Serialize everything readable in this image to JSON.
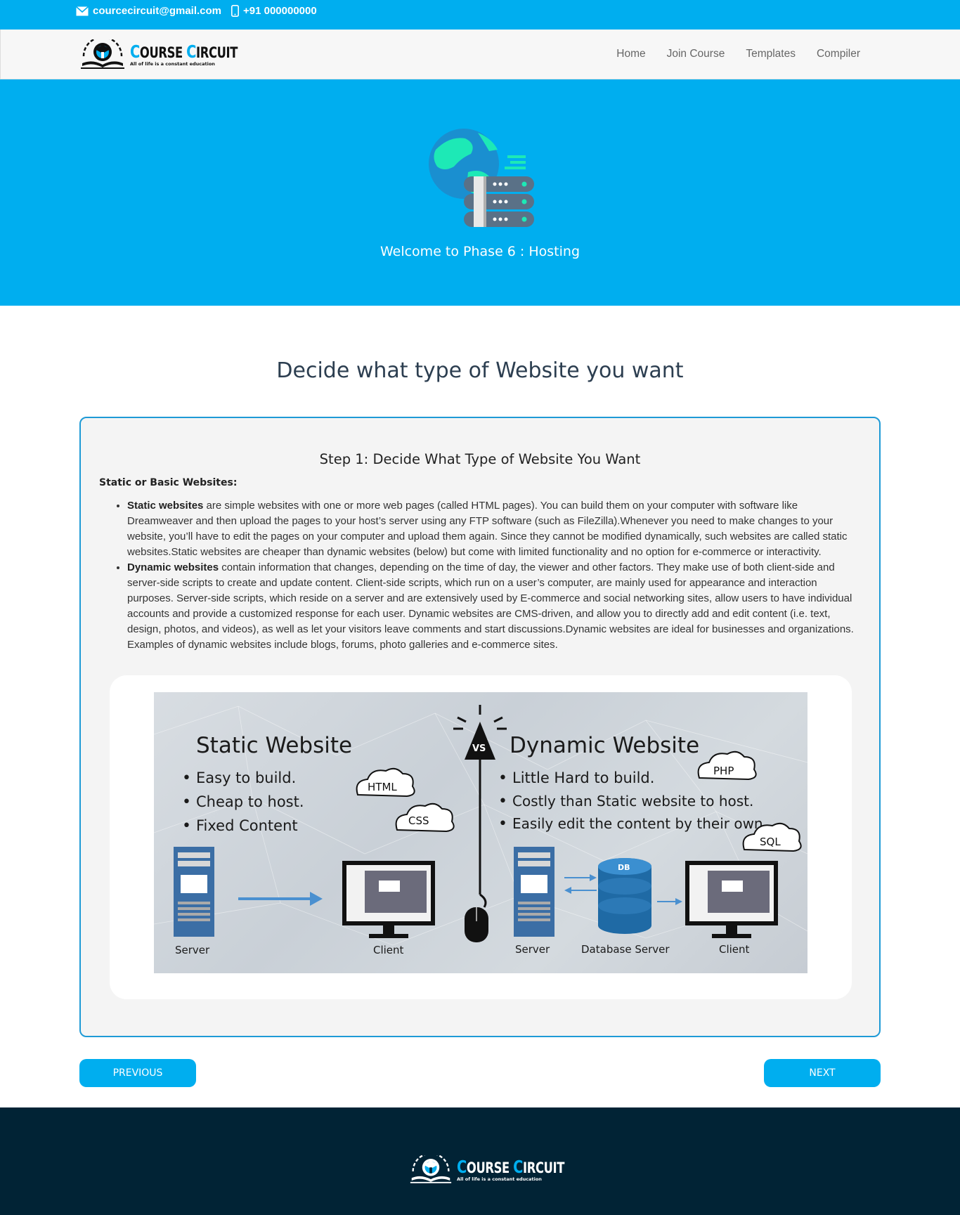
{
  "topbar": {
    "email": "courcecircuit@gmail.com",
    "phone": "+91 000000000"
  },
  "brand": {
    "name_first_cap": "C",
    "name_first_rest": "OURSE",
    "name_second_cap": "C",
    "name_second_rest": "IRCUIT",
    "tagline": "All of life is a constant education"
  },
  "nav": {
    "items": [
      {
        "label": "Home"
      },
      {
        "label": "Join Course"
      },
      {
        "label": "Templates"
      },
      {
        "label": "Compiler"
      }
    ]
  },
  "hero": {
    "title": "Welcome to Phase 6 : Hosting"
  },
  "main": {
    "title": "Decide what type of Website you want"
  },
  "card": {
    "step_title": "Step 1: Decide What Type of Website You Want",
    "section_label": "Static or Basic Websites:",
    "items": [
      {
        "term": "Static websites",
        "text": " are simple websites with one or more web pages (called HTML pages). You can build them on your computer with software like Dreamweaver and then upload the pages to your host’s server using any FTP software (such as FileZilla).Whenever you need to make changes to your website, you’ll have to edit the pages on your computer and upload them again. Since they cannot be modified dynamically, such websites are called static websites.Static websites are cheaper than dynamic websites (below) but come with limited functionality and no option for e-commerce or interactivity."
      },
      {
        "term": "Dynamic websites",
        "text": " contain information that changes, depending on the time of day, the viewer and other factors. They make use of both client-side and server-side scripts to create and update content. Client-side scripts, which run on a user’s computer, are mainly used for appearance and interaction purposes. Server-side scripts, which reside on a server and are extensively used by E-commerce and social networking sites, allow users to have individual accounts and provide a customized response for each user. Dynamic websites are CMS-driven, and allow you to directly add and edit content (i.e. text, design, photos, and videos), as well as let your visitors leave comments and start discussions.Dynamic websites are ideal for businesses and organizations. Examples of dynamic websites include blogs, forums, photo galleries and e-commerce sites."
      }
    ]
  },
  "infographic": {
    "static_title": "Static Website",
    "static_points": [
      "Easy to build.",
      "Cheap to host.",
      "Fixed Content"
    ],
    "dynamic_title": "Dynamic Website",
    "dynamic_points": [
      "Little Hard to build.",
      "Costly than Static website to host.",
      "Easily edit the content by their own."
    ],
    "vs": "VS",
    "clouds": [
      "HTML",
      "CSS",
      "PHP",
      "SQL"
    ],
    "db_badge": "DB",
    "labels": {
      "server_left": "Server",
      "client_left": "Client",
      "server_right": "Server",
      "database": "Database Server",
      "client_right": "Client"
    }
  },
  "buttons": {
    "previous": "PREVIOUS",
    "next": "NEXT"
  }
}
